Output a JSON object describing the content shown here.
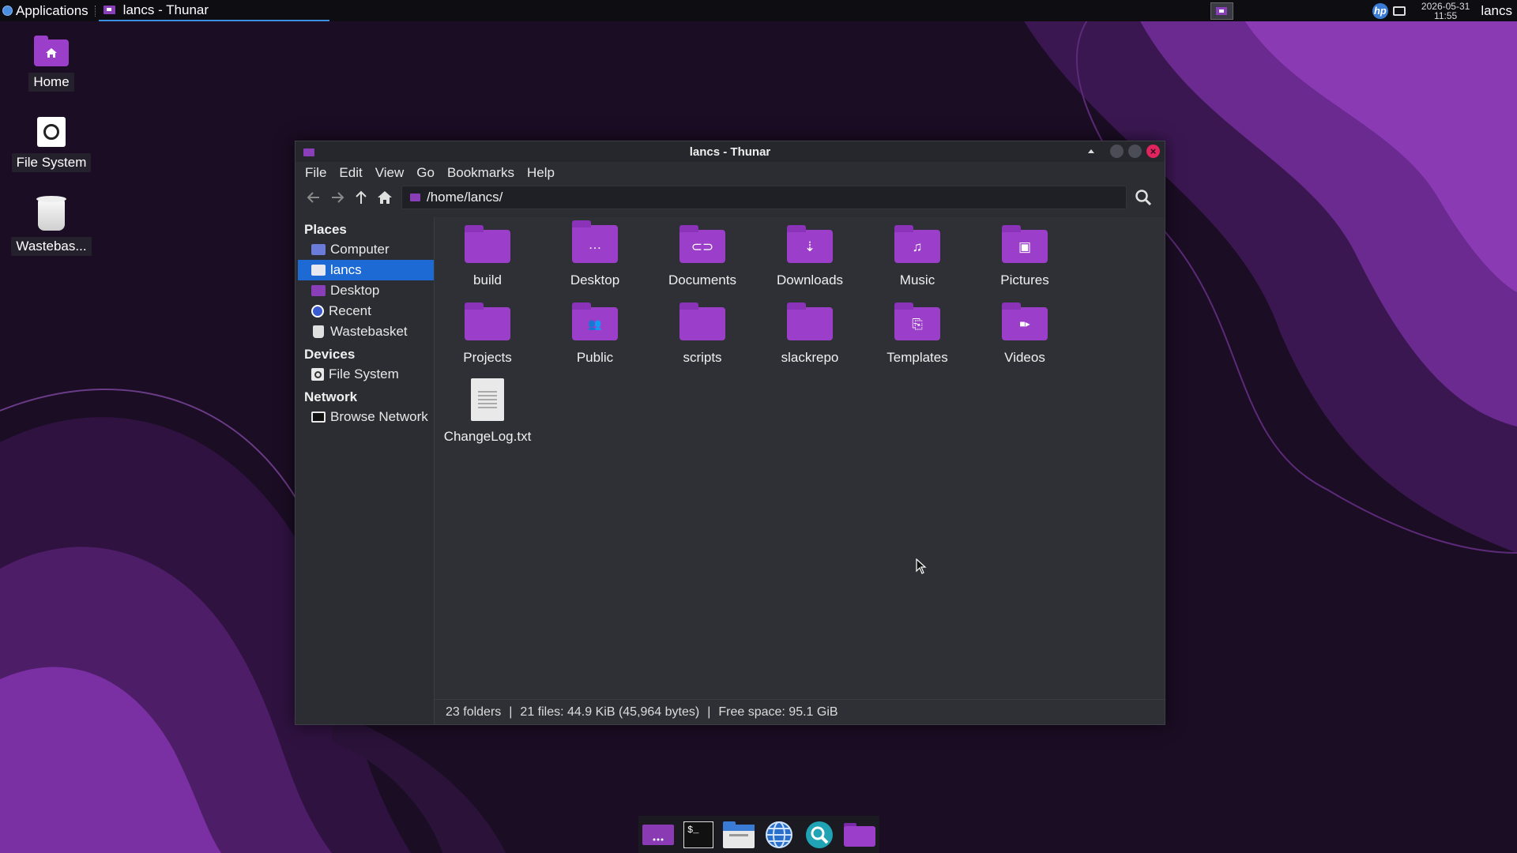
{
  "panel": {
    "applications_label": "Applications",
    "task_title": "lancs - Thunar",
    "clock_date": "2026-05-31",
    "clock_time": "11:55",
    "user": "lancs"
  },
  "desktop": {
    "icons": [
      {
        "label": "Home",
        "icon": "home-folder-icon"
      },
      {
        "label": "File System",
        "icon": "drive-icon"
      },
      {
        "label": "Wastebas...",
        "icon": "trash-icon"
      }
    ]
  },
  "window": {
    "title": "lancs - Thunar",
    "menu": [
      "File",
      "Edit",
      "View",
      "Go",
      "Bookmarks",
      "Help"
    ],
    "location": "/home/lancs/",
    "sidebar": {
      "places_header": "Places",
      "places": [
        {
          "label": "Computer",
          "icon": "computer-icon"
        },
        {
          "label": "lancs",
          "icon": "home-icon",
          "selected": true
        },
        {
          "label": "Desktop",
          "icon": "desktop-icon"
        },
        {
          "label": "Recent",
          "icon": "recent-icon"
        },
        {
          "label": "Wastebasket",
          "icon": "trash-icon"
        }
      ],
      "devices_header": "Devices",
      "devices": [
        {
          "label": "File System",
          "icon": "drive-icon"
        }
      ],
      "network_header": "Network",
      "network": [
        {
          "label": "Browse Network",
          "icon": "network-icon"
        }
      ]
    },
    "items": [
      {
        "name": "build",
        "type": "folder",
        "emblem": ""
      },
      {
        "name": "Desktop",
        "type": "folder",
        "emblem": "…"
      },
      {
        "name": "Documents",
        "type": "folder",
        "emblem": "⊂⊃"
      },
      {
        "name": "Downloads",
        "type": "folder",
        "emblem": "⇣"
      },
      {
        "name": "Music",
        "type": "folder",
        "emblem": "♫"
      },
      {
        "name": "Pictures",
        "type": "folder",
        "emblem": "▣"
      },
      {
        "name": "Projects",
        "type": "folder",
        "emblem": ""
      },
      {
        "name": "Public",
        "type": "folder",
        "emblem": "👥"
      },
      {
        "name": "scripts",
        "type": "folder",
        "emblem": ""
      },
      {
        "name": "slackrepo",
        "type": "folder",
        "emblem": ""
      },
      {
        "name": "Templates",
        "type": "folder",
        "emblem": "⎘"
      },
      {
        "name": "Videos",
        "type": "folder",
        "emblem": "■▸"
      },
      {
        "name": "ChangeLog.txt",
        "type": "file",
        "emblem": ""
      }
    ],
    "status": {
      "folders": "23 folders",
      "files": "21 files: 44.9 KiB (45,964 bytes)",
      "free": "Free space: 95.1 GiB",
      "separator": "|"
    }
  },
  "colors": {
    "accent": "#1e6ad4",
    "folder": "#9b3ec9",
    "close_button": "#e0245e"
  }
}
